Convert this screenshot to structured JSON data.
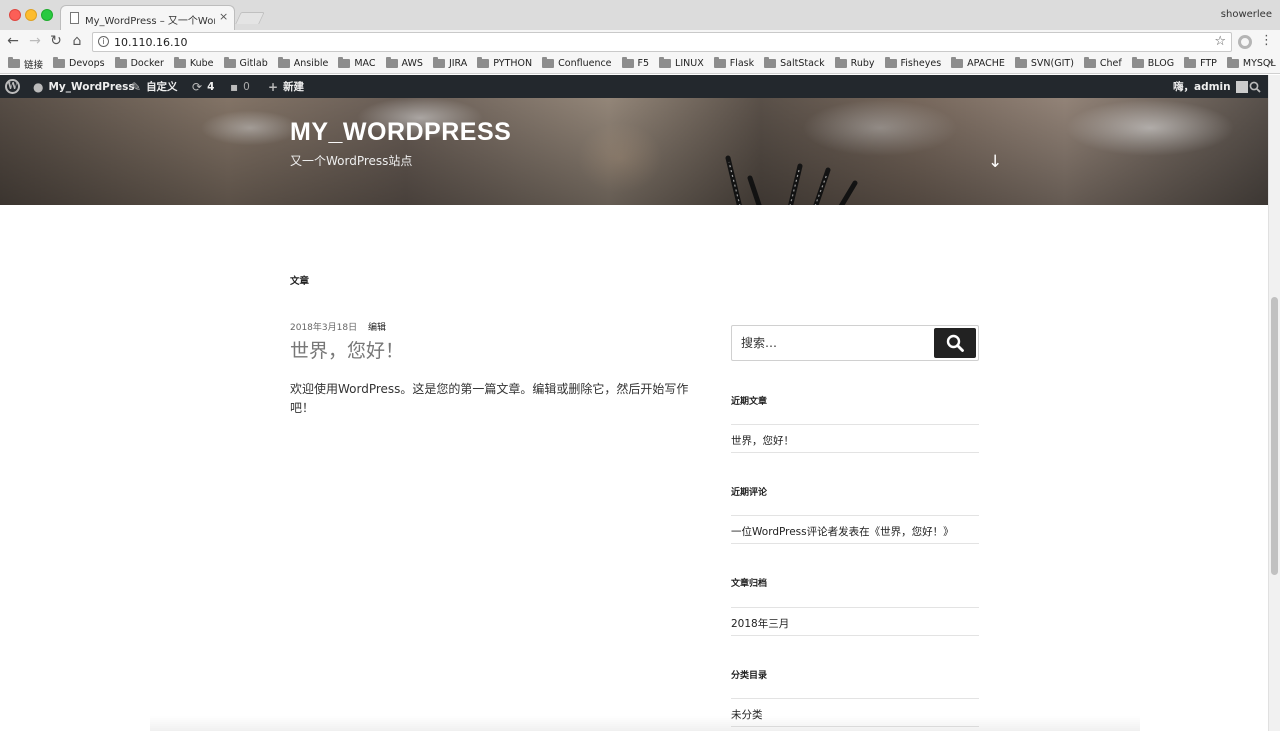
{
  "browser": {
    "tab_title": "My_WordPress – 又一个WordPress站点",
    "tab_close": "×",
    "profile_name": "showerlee",
    "url": "10.110.16.10",
    "bookmarks": [
      "链接",
      "Devops",
      "Docker",
      "Kube",
      "Gitlab",
      "Ansible",
      "MAC",
      "AWS",
      "JIRA",
      "PYTHON",
      "Confluence",
      "F5",
      "LINUX",
      "Flask",
      "SaltStack",
      "Ruby",
      "Fisheyes",
      "APACHE",
      "SVN(GIT)",
      "Chef",
      "BLOG",
      "FTP",
      "MYSQL"
    ],
    "bookmarks_more": "»"
  },
  "adminbar": {
    "site_name": "My_WordPress",
    "customize": "自定义",
    "updates_count": "4",
    "comments_count": "0",
    "new": "新建",
    "greeting": "嗨，admin"
  },
  "header": {
    "site_title": "MY_WORDPRESS",
    "site_description": "又一个WordPress站点"
  },
  "main": {
    "section_title": "文章",
    "post": {
      "date": "2018年3月18日",
      "edit": "编辑",
      "title": "世界，您好！",
      "body": "欢迎使用WordPress。这是您的第一篇文章。编辑或删除它，然后开始写作吧！"
    }
  },
  "sidebar": {
    "search_placeholder": "搜索…",
    "widgets": [
      {
        "title": "近期文章",
        "item": "世界，您好！"
      },
      {
        "title": "近期评论",
        "item": "一位WordPress评论者发表在《世界，您好！》"
      },
      {
        "title": "文章归档",
        "item": "2018年三月"
      },
      {
        "title": "分类目录",
        "item": "未分类"
      }
    ]
  }
}
